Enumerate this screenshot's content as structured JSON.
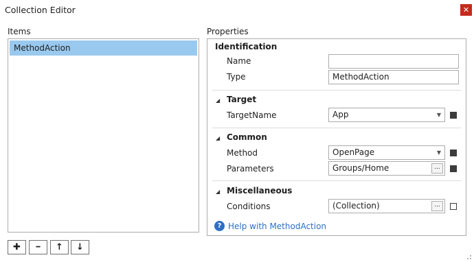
{
  "window": {
    "title": "Collection Editor",
    "close_glyph": "✕"
  },
  "items_panel": {
    "label": "Items",
    "items": [
      "MethodAction"
    ],
    "selected_index": 0,
    "buttons": [
      {
        "name": "add-item-button",
        "icon": "plus-icon",
        "glyph": "✚"
      },
      {
        "name": "remove-item-button",
        "icon": "minus-icon",
        "glyph": "━"
      },
      {
        "name": "move-up-button",
        "icon": "arrow-up-icon",
        "glyph": "↑"
      },
      {
        "name": "move-down-button",
        "icon": "arrow-down-icon",
        "glyph": "↓"
      }
    ]
  },
  "properties_panel": {
    "label": "Properties",
    "identification": {
      "title": "Identification",
      "name_label": "Name",
      "name_value": "",
      "type_label": "Type",
      "type_value": "MethodAction"
    },
    "target": {
      "title": "Target",
      "arrow": "◢",
      "targetname_label": "TargetName",
      "targetname_value": "App"
    },
    "common": {
      "title": "Common",
      "arrow": "◢",
      "method_label": "Method",
      "method_value": "OpenPage",
      "parameters_label": "Parameters",
      "parameters_value": "Groups/Home"
    },
    "miscellaneous": {
      "title": "Miscellaneous",
      "arrow": "◢",
      "conditions_label": "Conditions",
      "conditions_value": "(Collection)"
    },
    "dropdown_glyph": "▼",
    "ellipsis_glyph": "...",
    "help": {
      "icon": "help-icon",
      "glyph": "?",
      "text": "Help with MethodAction"
    }
  },
  "colors": {
    "selection": "#99c9ef",
    "close": "#c42b1c",
    "link": "#2f6fc4"
  }
}
